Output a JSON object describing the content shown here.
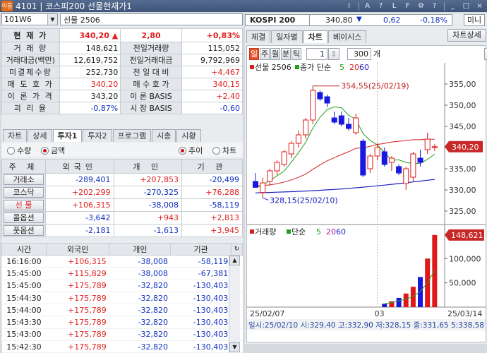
{
  "window": {
    "badge": "이름",
    "title": "4101 | 코스피200 선물현재가1",
    "controls": [
      "I",
      "A",
      "?",
      "L",
      "F",
      "⚙",
      "?",
      "_",
      "□",
      "×"
    ]
  },
  "code": {
    "value": "101W6",
    "name": "선물 2506"
  },
  "quote": {
    "rows": [
      {
        "l1": "현 재 가",
        "v1": "340,20 ▲",
        "v1b": "2,80",
        "v1c": "+0,83%"
      },
      {
        "l1": "거 래 량",
        "v1": "148,621",
        "l2": "전일거래량",
        "v2": "115,052"
      },
      {
        "l1": "거래대금(백만)",
        "v1": "12,619,752",
        "l2": "전일거래대금",
        "v2": "9,792,969"
      },
      {
        "l1": "미결제수량",
        "v1": "252,730",
        "l2": "전 일 대 비",
        "v2": "+4,467"
      },
      {
        "l1": "매 도 호 가",
        "v1": "340,20",
        "l2": "매 수 호 가",
        "v2": "340,15"
      },
      {
        "l1": "이 론 가 격",
        "v1": "343,20",
        "l2": "이 론 BASIS",
        "v2": "+2,40"
      },
      {
        "l1": "괴 리 율",
        "v1": "-0,87%",
        "l2": "시 장 BASIS",
        "v2": "-0,60"
      }
    ]
  },
  "tabs_left": [
    "차트",
    "상세",
    "투자1",
    "투자2",
    "프로그램",
    "시총",
    "시황"
  ],
  "radios": {
    "a": "수량",
    "b": "금액",
    "c": "추이",
    "d": "차트"
  },
  "investor": {
    "headers": [
      "주 체",
      "외국인",
      "개 인",
      "기 관"
    ],
    "rows": [
      {
        "label": "거래소",
        "f": "-289,401",
        "p": "+207,853",
        "i": "-20,499"
      },
      {
        "label": "코스닥",
        "f": "+202,299",
        "p": "-270,325",
        "i": "+76,288"
      },
      {
        "label": "선 물",
        "f": "+106,315",
        "p": "-38,008",
        "i": "-58,119"
      },
      {
        "label": "콜옵션",
        "f": "-3,642",
        "p": "+943",
        "i": "+2,813"
      },
      {
        "label": "풋옵션",
        "f": "-2,181",
        "p": "-1,613",
        "i": "+3,945"
      }
    ]
  },
  "ticks": {
    "headers": [
      "시간",
      "외국인",
      "개인",
      "기관"
    ],
    "rows": [
      [
        "16:16:00",
        "+106,315",
        "-38,008",
        "-58,119"
      ],
      [
        "15:45:00",
        "+115,829",
        "-38,008",
        "-67,381"
      ],
      [
        "15:45:00",
        "+175,789",
        "-32,820",
        "-130,403"
      ],
      [
        "15:44:30",
        "+175,789",
        "-32,820",
        "-130,403"
      ],
      [
        "15:44:00",
        "+175,789",
        "-32,820",
        "-130,403"
      ],
      [
        "15:43:30",
        "+175,789",
        "-32,820",
        "-130,403"
      ],
      [
        "15:43:00",
        "+175,789",
        "-32,820",
        "-130,403"
      ],
      [
        "15:42:30",
        "+175,789",
        "-32,820",
        "-130,403"
      ]
    ]
  },
  "kospi": {
    "name": "KOSPI 200",
    "value": "340,80",
    "change": "0,62",
    "pct": "-0,18%",
    "mini": "미니"
  },
  "tabs_right": [
    "체결",
    "일자별",
    "차트",
    "베이시스"
  ],
  "chart_button": "차트상세",
  "chart_tools": {
    "periods": [
      "일",
      "주",
      "월",
      "분",
      "틱"
    ],
    "count": "1",
    "bars": "300",
    "bars_unit": "개"
  },
  "chart_data": {
    "type": "candlestick",
    "price_legend": "선물 2506",
    "ma_legend": "종가 단순",
    "ma_periods": [
      "5",
      "20",
      "60"
    ],
    "volume_legend": "거래량",
    "volume_ma_legend": "단순",
    "volume_ma_periods": [
      "5",
      "20",
      "60"
    ],
    "price_ticks": [
      "355,00",
      "350,00",
      "345,00",
      "340,00",
      "335,00",
      "330,00",
      "325,00"
    ],
    "current_price": "340,20",
    "high_note": "354,55(25/02/19)",
    "low_note": "328,15(25/02/10)",
    "volume_ticks": [
      "100,000",
      "50,000"
    ],
    "current_volume": "148,621",
    "x_labels": [
      "25/02/07",
      "03",
      "25/03/14"
    ],
    "status": "일시:25/02/10 시:329,40 고:332,90 저:328,15 종:331,65 5:338,58",
    "candles": [
      {
        "o": 332.0,
        "h": 334.0,
        "l": 330.5,
        "c": 330.6
      },
      {
        "o": 329.4,
        "h": 332.9,
        "l": 328.15,
        "c": 331.65
      },
      {
        "o": 332.0,
        "h": 335.0,
        "l": 331.0,
        "c": 334.5
      },
      {
        "o": 334.5,
        "h": 337.0,
        "l": 333.5,
        "c": 336.5
      },
      {
        "o": 336.0,
        "h": 339.5,
        "l": 335.5,
        "c": 339.0
      },
      {
        "o": 338.5,
        "h": 341.5,
        "l": 337.5,
        "c": 341.0
      },
      {
        "o": 341.0,
        "h": 344.0,
        "l": 340.0,
        "c": 343.0
      },
      {
        "o": 343.0,
        "h": 347.0,
        "l": 342.0,
        "c": 346.5
      },
      {
        "o": 346.5,
        "h": 354.55,
        "l": 345.5,
        "c": 353.5
      },
      {
        "o": 353.0,
        "h": 353.5,
        "l": 351.0,
        "c": 351.5
      },
      {
        "o": 352.0,
        "h": 352.5,
        "l": 349.5,
        "c": 350.5
      },
      {
        "o": 347.0,
        "h": 348.5,
        "l": 345.5,
        "c": 346.0
      },
      {
        "o": 347.5,
        "h": 348.5,
        "l": 345.0,
        "c": 345.5
      },
      {
        "o": 345.5,
        "h": 347.0,
        "l": 344.0,
        "c": 344.5
      },
      {
        "o": 343.5,
        "h": 348.0,
        "l": 343.0,
        "c": 347.0
      },
      {
        "o": 341.5,
        "h": 342.0,
        "l": 333.0,
        "c": 333.5
      },
      {
        "o": 335.0,
        "h": 338.5,
        "l": 334.0,
        "c": 338.0
      },
      {
        "o": 338.0,
        "h": 341.0,
        "l": 337.0,
        "c": 340.0
      },
      {
        "o": 339.0,
        "h": 340.0,
        "l": 335.5,
        "c": 336.0
      },
      {
        "o": 336.5,
        "h": 338.0,
        "l": 334.5,
        "c": 337.5
      },
      {
        "o": 335.5,
        "h": 336.0,
        "l": 333.5,
        "c": 334.0
      },
      {
        "o": 331.5,
        "h": 335.5,
        "l": 330.0,
        "c": 335.0
      },
      {
        "o": 333.0,
        "h": 339.0,
        "l": 332.0,
        "c": 338.5
      },
      {
        "o": 337.5,
        "h": 339.5,
        "l": 335.5,
        "c": 336.5
      },
      {
        "o": 339.5,
        "h": 343.5,
        "l": 338.5,
        "c": 342.0
      },
      {
        "o": 340.0,
        "h": 340.8,
        "l": 339.2,
        "c": 340.2
      }
    ],
    "volumes": [
      0,
      0,
      0,
      0,
      0,
      0,
      0,
      0,
      0,
      0,
      0,
      0,
      0,
      0,
      0,
      0,
      0,
      0,
      7000,
      12000,
      19000,
      28000,
      42000,
      62000,
      100000,
      148621
    ]
  }
}
